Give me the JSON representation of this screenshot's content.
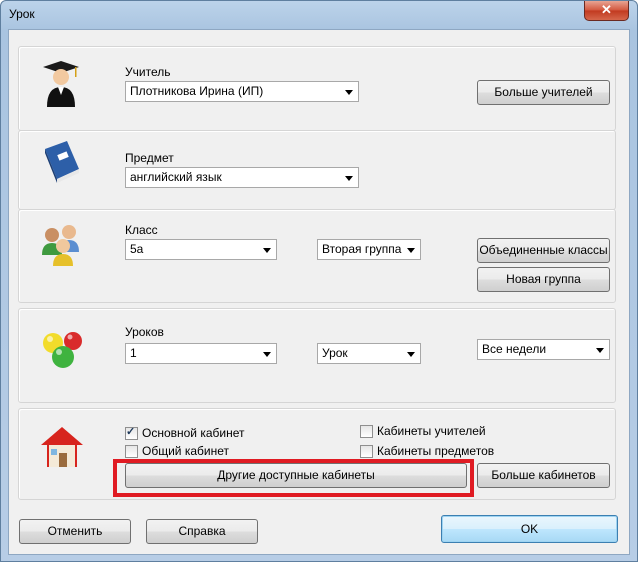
{
  "window": {
    "title": "Урок",
    "close_glyph": "✕"
  },
  "teacher": {
    "label": "Учитель",
    "value": "Плотникова Ирина (ИП)",
    "more_button": "Больше учителей",
    "icon": "teacher-graduate-icon"
  },
  "subject": {
    "label": "Предмет",
    "value": "английский язык",
    "icon": "book-icon"
  },
  "class": {
    "label": "Класс",
    "value": "5а",
    "group_value": "Вторая группа",
    "merged_button": "Объединенные классы",
    "new_group_button": "Новая группа",
    "icon": "students-group-icon"
  },
  "lessons": {
    "label": "Уроков",
    "count_value": "1",
    "type_value": "Урок",
    "weeks_value": "Все недели",
    "icon": "colored-balls-icon"
  },
  "rooms": {
    "icon": "house-icon",
    "main_room": {
      "label": "Основной кабинет",
      "checked": true
    },
    "shared_room": {
      "label": "Общий кабинет",
      "checked": false
    },
    "teacher_rooms": {
      "label": "Кабинеты учителей",
      "checked": false
    },
    "subject_rooms": {
      "label": "Кабинеты предметов",
      "checked": false
    },
    "other_available_button": "Другие доступные кабинеты",
    "more_rooms_button": "Больше кабинетов"
  },
  "footer": {
    "cancel": "Отменить",
    "help": "Справка",
    "ok": "OK"
  },
  "colors": {
    "highlight": "#e01b23",
    "close": "#c1391f"
  }
}
